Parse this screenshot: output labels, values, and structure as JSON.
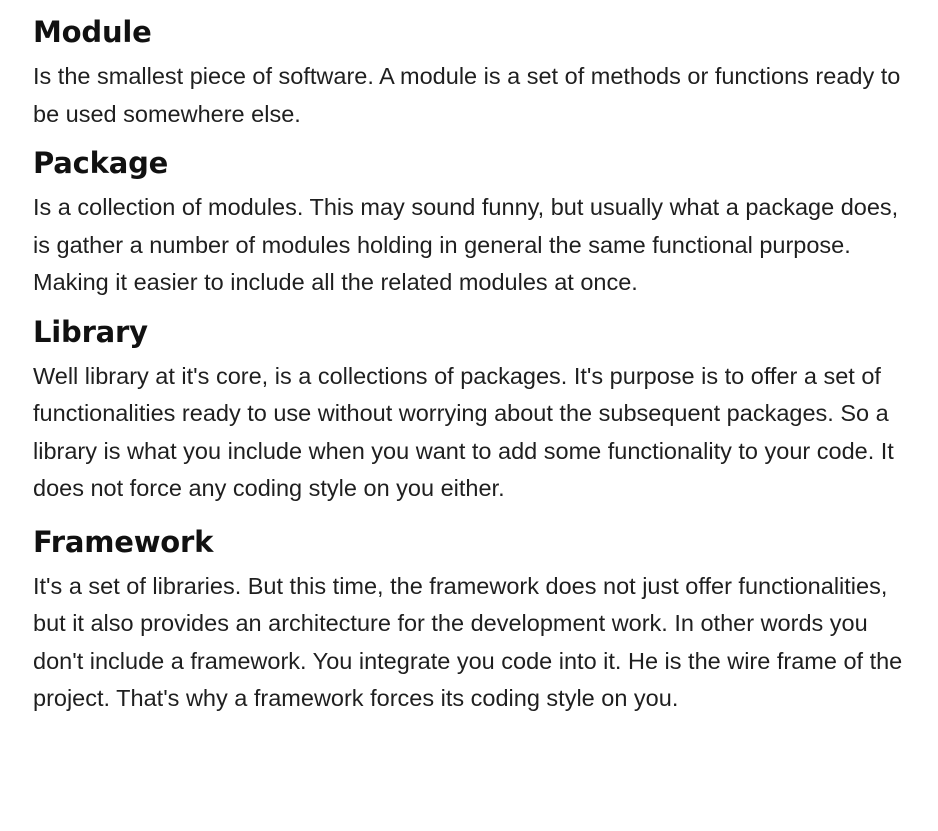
{
  "sections": [
    {
      "heading": "Module",
      "body": "Is the smallest piece of software. A module is a set of methods or functions ready to be used somewhere else."
    },
    {
      "heading": "Package",
      "body": "Is a collection of modules. This may sound funny, but usually what a package does, is gather a number of modules holding in general the same functional purpose. Making it easier to include all the related modules at once."
    },
    {
      "heading": "Library",
      "body": "Well library at it's core, is a collections of packages. It's purpose is to offer a set of functionalities ready to use without worrying about the subsequent packages. So a library is what you include when you want to add some functionality to your code. It does not force any coding style on you either."
    },
    {
      "heading": "Framework",
      "body": "It's a set of libraries. But this time, the framework does not just offer functionalities, but it also provides an architecture for the development work. In other words you don't include a framework. You integrate you code into it. He is the wire frame of the project. That's why a framework forces its coding style on you."
    }
  ]
}
